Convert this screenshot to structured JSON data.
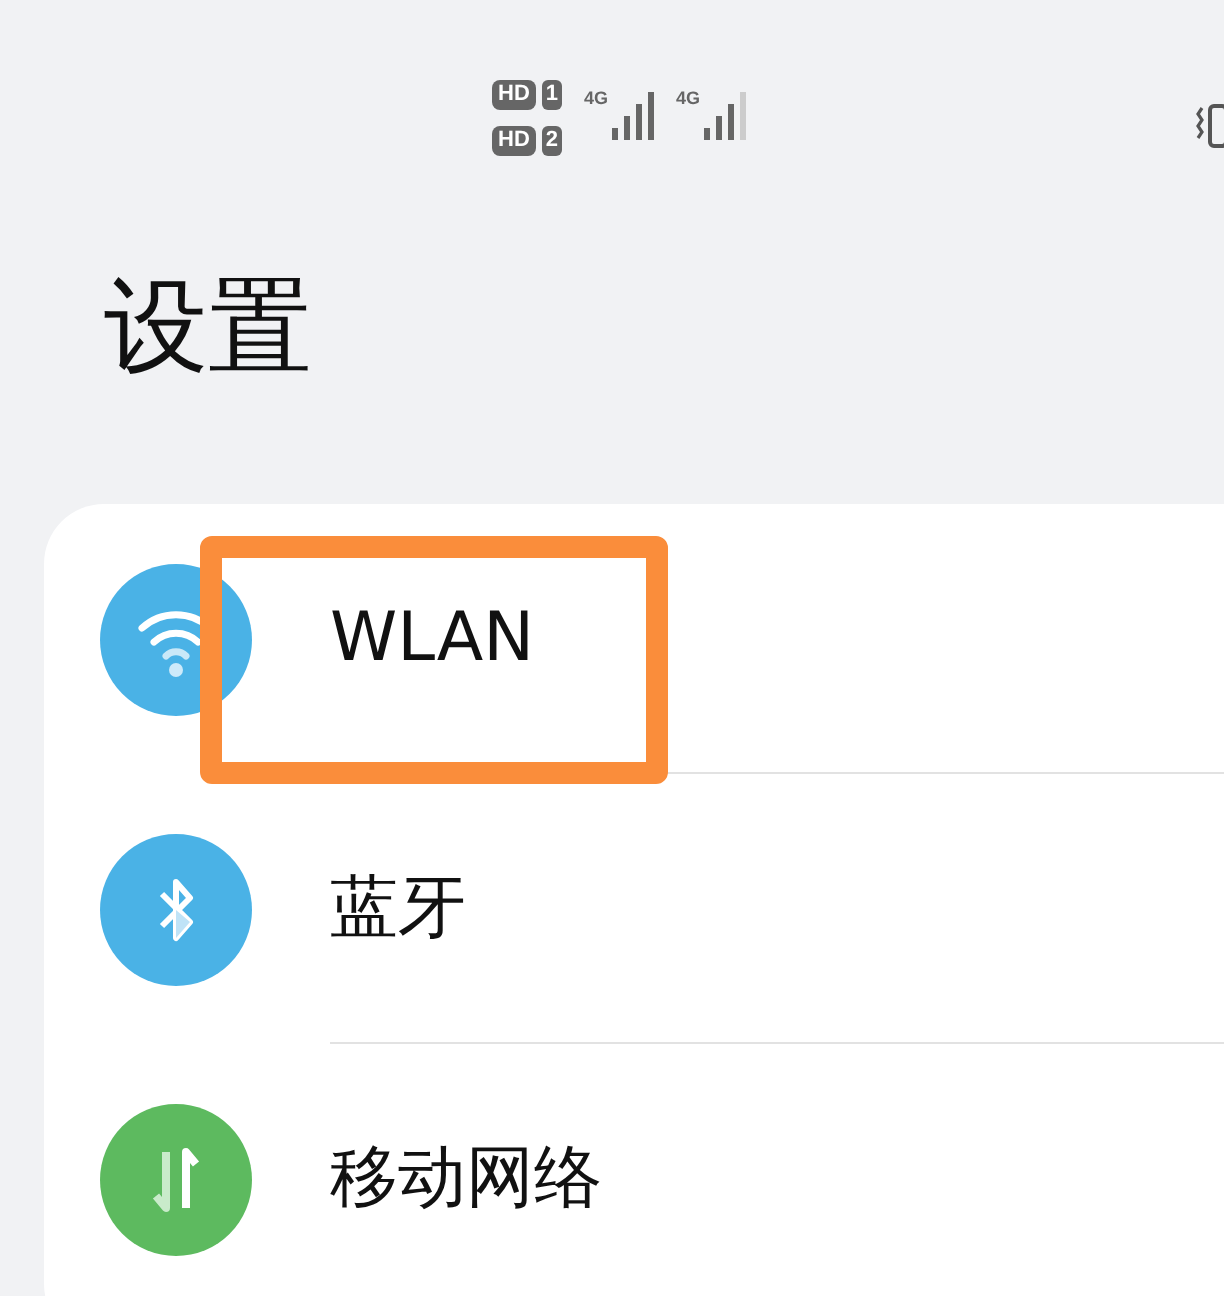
{
  "status_bar": {
    "sims": [
      {
        "badge": "HD",
        "slot": "1",
        "network": "4G"
      },
      {
        "badge": "HD",
        "slot": "2",
        "network": "4G"
      }
    ]
  },
  "title": "设置",
  "settings": [
    {
      "label": "WLAN",
      "kind": "wifi",
      "color": "#4ab2e6",
      "highlighted": true
    },
    {
      "label": "蓝牙",
      "kind": "bluetooth",
      "color": "#4ab2e6",
      "highlighted": false
    },
    {
      "label": "移动网络",
      "kind": "mobile",
      "color": "#5dba5f",
      "highlighted": false
    }
  ]
}
